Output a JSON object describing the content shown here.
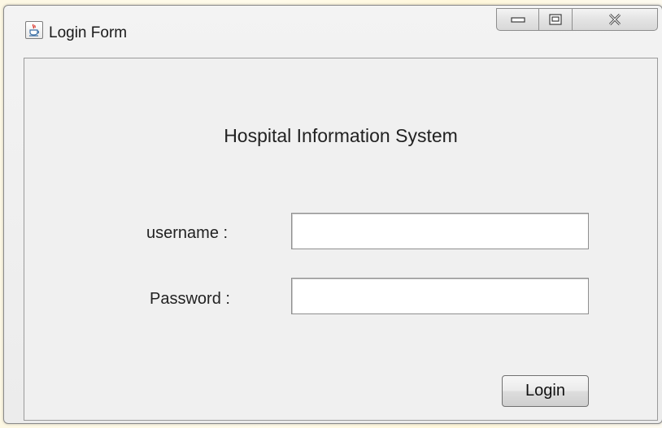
{
  "window": {
    "title": "Login Form",
    "app_icon": "java-cup-icon",
    "controls": {
      "minimize": "minimize-icon",
      "maximize": "maximize-icon",
      "close": "close-icon"
    }
  },
  "form": {
    "heading": "Hospital Information System",
    "username_label": "username :",
    "username_value": "",
    "password_label": "Password :",
    "password_value": "",
    "login_label": "Login"
  },
  "colors": {
    "window_bg": "#f0f0f0",
    "border": "#8f8f8f",
    "text": "#222222",
    "desktop": "#fffbea"
  }
}
